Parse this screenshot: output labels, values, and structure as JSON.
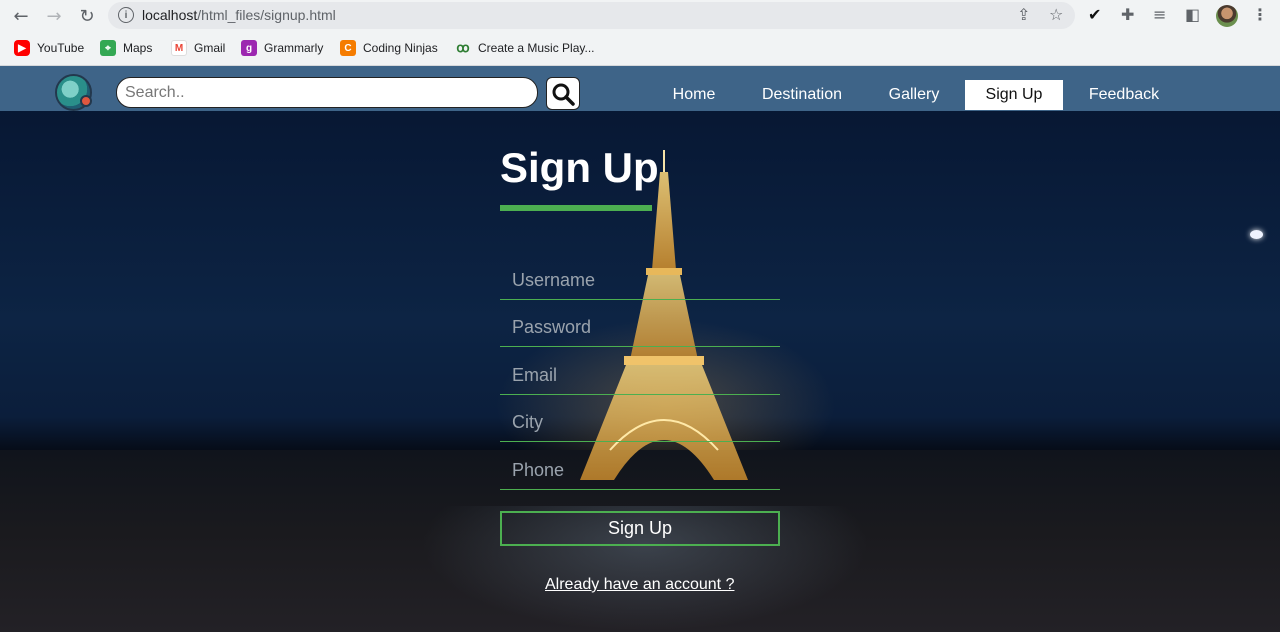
{
  "browser": {
    "url_host": "localhost",
    "url_path": "/html_files/signup.html",
    "bookmarks": [
      {
        "label": "YouTube",
        "icon": "youtube-icon",
        "color": "#ff0000"
      },
      {
        "label": "Maps",
        "icon": "maps-icon",
        "color": "#34a853"
      },
      {
        "label": "Gmail",
        "icon": "gmail-icon",
        "color": "#ea4335"
      },
      {
        "label": "Grammarly",
        "icon": "grammarly-icon",
        "color": "#9c27b0"
      },
      {
        "label": "Coding Ninjas",
        "icon": "coding-ninjas-icon",
        "color": "#f57c00"
      },
      {
        "label": "Create a Music Play...",
        "icon": "music-icon",
        "color": "#2e7d32"
      }
    ]
  },
  "site": {
    "search": {
      "placeholder": "Search.."
    },
    "nav": {
      "items": [
        "Home",
        "Destination",
        "Gallery",
        "Sign Up",
        "Feedback"
      ],
      "active": "Sign Up"
    },
    "form": {
      "title": "Sign Up",
      "fields": [
        "Username",
        "Password",
        "Email",
        "City",
        "Phone"
      ],
      "submit_label": "Sign Up",
      "login_link": "Already have an account ?"
    },
    "colors": {
      "navbar": "#3e6488",
      "accent": "#4caf50"
    }
  }
}
